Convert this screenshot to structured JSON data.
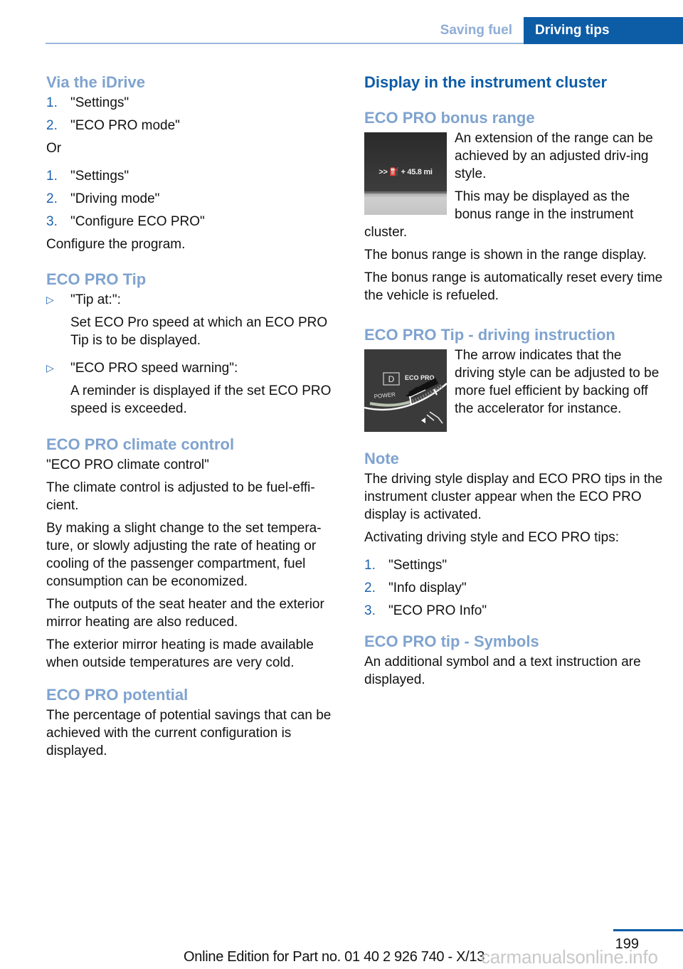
{
  "header": {
    "tabs": [
      {
        "label": "Saving fuel",
        "active": false
      },
      {
        "label": "Driving tips",
        "active": true
      }
    ]
  },
  "left_column": {
    "via_idrive": {
      "heading": "Via the iDrive",
      "list_a": [
        {
          "num": "1.",
          "text": "\"Settings\""
        },
        {
          "num": "2.",
          "text": "\"ECO PRO mode\""
        }
      ],
      "or_label": "Or",
      "list_b": [
        {
          "num": "1.",
          "text": "\"Settings\""
        },
        {
          "num": "2.",
          "text": "\"Driving mode\""
        },
        {
          "num": "3.",
          "text": "\"Configure ECO PRO\""
        }
      ],
      "footer_text": "Configure the program."
    },
    "eco_pro_tip": {
      "heading": "ECO PRO Tip",
      "bullet_icon": "triangle-right-icon",
      "items": [
        {
          "title": "\"Tip at:\":",
          "text": "Set ECO Pro speed at which an ECO PRO Tip is to be displayed."
        },
        {
          "title": "\"ECO PRO speed warning\":",
          "text": "A reminder is displayed if the set ECO PRO speed is exceeded."
        }
      ]
    },
    "climate": {
      "heading": "ECO PRO climate control",
      "paragraphs": [
        "\"ECO PRO climate control\"",
        "The climate control is adjusted to be fuel-effi-cient.",
        "By making a slight change to the set tempera-ture, or slowly adjusting the rate of heating or cooling of the passenger compartment, fuel consumption can be economized.",
        "The outputs of the seat heater and the exterior mirror heating are also reduced.",
        "The exterior mirror heating is made available when outside temperatures are very cold."
      ]
    },
    "potential": {
      "heading": "ECO PRO potential",
      "text": "The percentage of potential savings that can be achieved with the current configuration is displayed."
    }
  },
  "right_column": {
    "main_heading": "Display in the instrument cluster",
    "bonus_range": {
      "heading": "ECO PRO bonus range",
      "figure_readout": ">> ⛽ + 45.8 mi",
      "paragraphs": [
        "An extension of the range can be achieved by an adjusted driv-ing style.",
        "This may be displayed as the bonus range in the instrument cluster.",
        "The bonus range is shown in the range display.",
        "The bonus range is automatically reset every time the vehicle is refueled."
      ]
    },
    "tip_driving": {
      "heading": "ECO PRO Tip - driving instruction",
      "figure_labels": {
        "gear": "D",
        "mode": "ECO PRO",
        "power": "POWER"
      },
      "text": "The arrow indicates that the driving style can be adjusted to be more fuel efficient by backing off the accelerator for instance."
    },
    "note": {
      "heading": "Note",
      "paragraphs": [
        "The driving style display and ECO PRO tips in the instrument cluster appear when the ECO PRO display is activated.",
        "Activating driving style and ECO PRO tips:"
      ],
      "list": [
        {
          "num": "1.",
          "text": "\"Settings\""
        },
        {
          "num": "2.",
          "text": "\"Info display\""
        },
        {
          "num": "3.",
          "text": "\"ECO PRO Info\""
        }
      ]
    },
    "symbols": {
      "heading": "ECO PRO tip - Symbols",
      "text": "An additional symbol and a text instruction are displayed."
    }
  },
  "footer": {
    "page_number": "199",
    "edition_text": "Online Edition for Part no. 01 40 2 926 740 - X/13",
    "watermark": "carmanualsonline.info"
  },
  "colors": {
    "accent_dark": "#0d5ca6",
    "accent_light": "#7fa3cf"
  }
}
